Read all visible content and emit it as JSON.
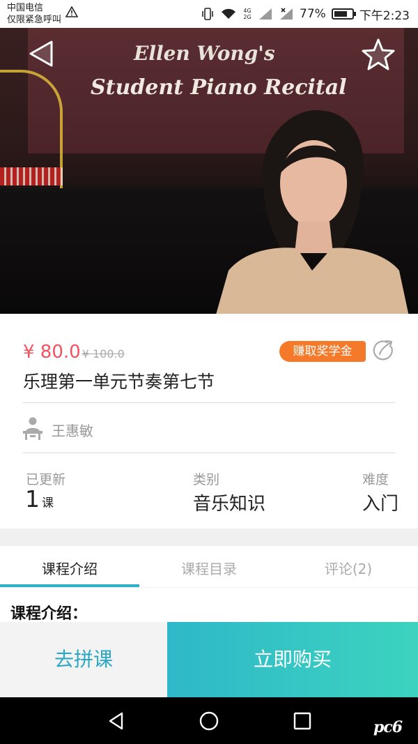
{
  "status_bar": {
    "carrier_line1": "中国电信",
    "carrier_line2": "仅限紧急呼叫",
    "network": "4G 2G",
    "battery": "77%",
    "battery_level": 0.77,
    "time": "下午2:23"
  },
  "hero": {
    "banner_line1": "Ellen Wong's",
    "banner_line2": "Student Piano Recital",
    "back_icon": "back-triangle-icon",
    "favorite_icon": "star-outline-icon"
  },
  "course": {
    "price": "¥ 80.0",
    "original_price": "¥ 100.0",
    "earn_badge": "赚取奖学金",
    "title": "乐理第一单元节奏第七节",
    "teacher": "王惠敏",
    "stats": {
      "updated_label": "已更新",
      "updated_count": "1",
      "updated_unit": "课",
      "category_label": "类别",
      "category_value": "音乐知识",
      "difficulty_label": "难度",
      "difficulty_value": "入门"
    }
  },
  "tabs": [
    {
      "label": "课程介绍",
      "active": true
    },
    {
      "label": "课程目录",
      "active": false
    },
    {
      "label": "评论(2)",
      "active": false
    }
  ],
  "section_heading": "课程介绍：",
  "actions": {
    "group_buy": "去拼课",
    "buy_now": "立即购买"
  },
  "watermark": "pc6",
  "colors": {
    "price": "#f2525f",
    "badge": "#f47a2a",
    "accent": "#2db0c8",
    "buy_gradient_start": "#2fb8c9",
    "buy_gradient_end": "#3cd3bf"
  }
}
